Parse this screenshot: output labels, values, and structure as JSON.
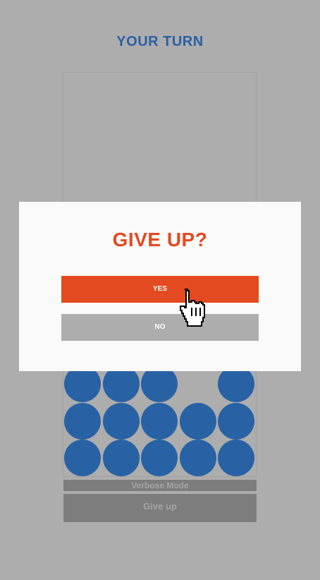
{
  "header": {
    "turn_label": "YOUR TURN"
  },
  "board": {
    "disc_color": "#2862a5",
    "visible_rows": [
      [
        1,
        1,
        1,
        0,
        1
      ],
      [
        1,
        1,
        1,
        1,
        1
      ],
      [
        1,
        1,
        1,
        1,
        1
      ]
    ]
  },
  "controls": {
    "verbose_label": "Verbose Mode",
    "give_up_label": "Give up"
  },
  "modal": {
    "title": "GIVE UP?",
    "yes_label": "YES",
    "no_label": "NO",
    "accent_color": "#e34a1f"
  },
  "cursor": {
    "icon": "hand-pointer-icon"
  }
}
